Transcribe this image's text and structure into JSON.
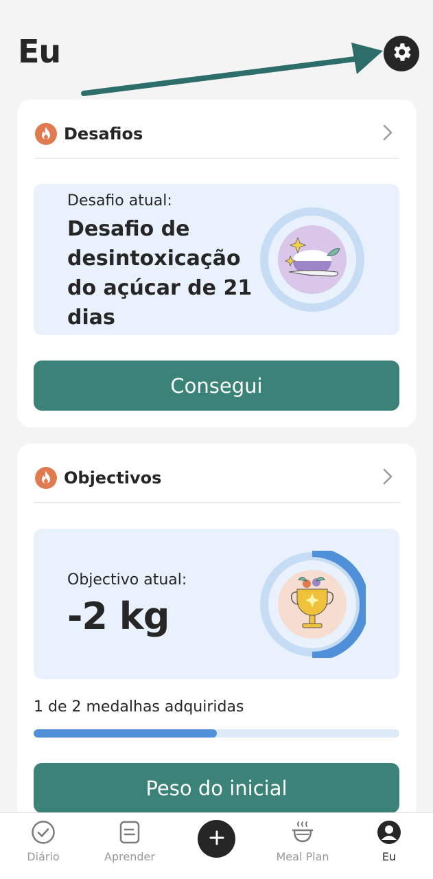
{
  "header": {
    "title": "Eu"
  },
  "challenges": {
    "title": "Desafios",
    "current_label": "Desafio atual:",
    "current_name": "Desafio de desintoxicação do açúcar de 21 dias",
    "button_label": "Consegui"
  },
  "goals": {
    "title": "Objectivos",
    "current_label": "Objectivo atual:",
    "current_value": "-2 kg",
    "progress_text": "1 de 2 medalhas adquiridas",
    "progress_fraction": 0.5,
    "button_label": "Peso do inicial"
  },
  "tabbar": {
    "items": [
      {
        "label": "Diário",
        "icon": "check-circle-icon"
      },
      {
        "label": "Aprender",
        "icon": "document-icon"
      },
      {
        "label": "",
        "icon": "add-icon"
      },
      {
        "label": "Meal Plan",
        "icon": "bowl-icon"
      },
      {
        "label": "Eu",
        "icon": "profile-icon"
      }
    ],
    "active": "Eu"
  },
  "colors": {
    "accent_green": "#3b8378",
    "flame_orange": "#e07a4f",
    "progress_blue": "#4f90d9",
    "annotation_arrow": "#2e6e6a"
  }
}
